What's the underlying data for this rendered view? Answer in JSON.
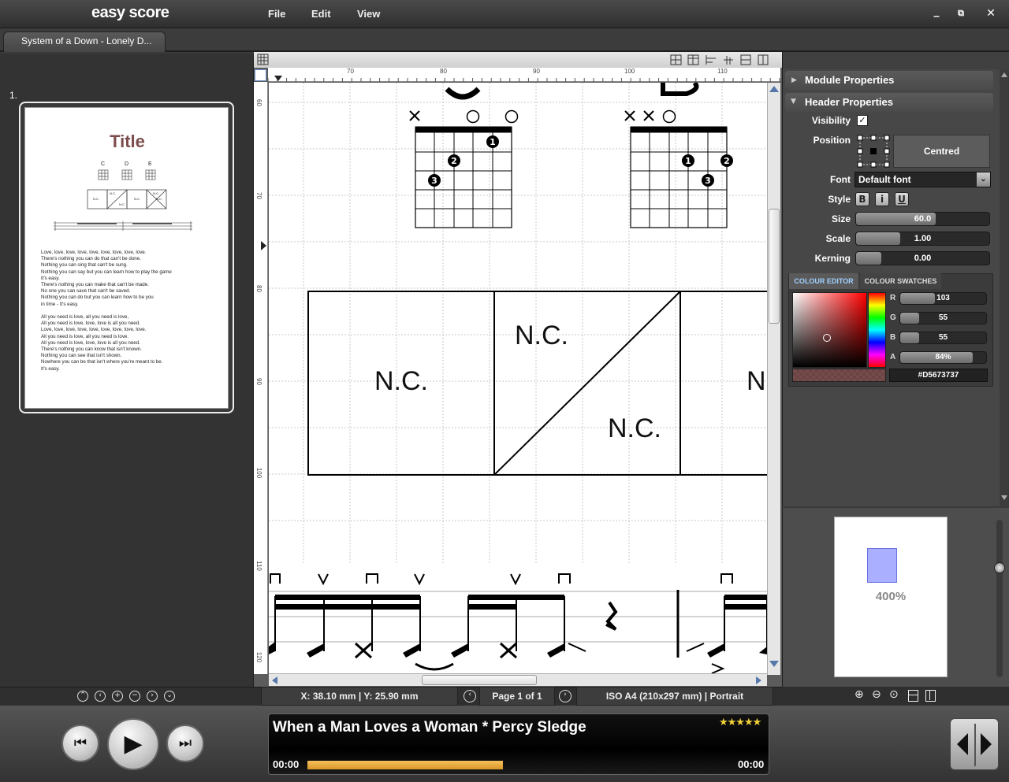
{
  "app": {
    "logo": "easy score",
    "menus": [
      "File",
      "Edit",
      "View"
    ],
    "window_controls": [
      "minimize-icon",
      "restore-icon",
      "close-icon"
    ]
  },
  "tab": {
    "label": "System of a Down - Lonely D..."
  },
  "pages_panel": {
    "page_number": "1.",
    "thumbnail": {
      "title": "Title",
      "chords": [
        "C",
        "D",
        "E"
      ],
      "boxes": [
        "N.C.",
        "N.C.",
        "N.C.",
        "N.C.",
        "N.C.",
        "N.C."
      ],
      "lyrics": [
        "Love, love, love, love, love, love, love, love, love.",
        "There's nothing you can do that can't be done.",
        "Nothing you can sing that can't be sung.",
        "Nothing you can say but you can learn how to play the game",
        "It's easy.",
        "There's nothing you can make that can't be made.",
        "No one you can save that can't be saved.",
        "Nothing you can do but you can learn how to be you",
        "in time - It's easy.",
        "",
        "All you need is love, all you need is love,",
        "All you need is love, love, love is all you need.",
        "Love, love, love, love, love, love, love, love, love.",
        "All you need is love, all you need is love.",
        "All you need is love, love, love is all you need.",
        "There's nothing you can know that isn't known.",
        "Nothing you can see that isn't shown.",
        "Nowhere you can be that isn't where you're meant to be.",
        "It's easy."
      ]
    },
    "nav_icons": [
      "first-page-icon",
      "previous-icon",
      "add-page-icon",
      "remove-page-icon",
      "next-icon",
      "last-page-icon"
    ]
  },
  "editor": {
    "ruler_top": [
      "70",
      "80",
      "90",
      "100",
      "110"
    ],
    "ruler_left": [
      "60",
      "70",
      "80",
      "90",
      "100",
      "110",
      "120"
    ],
    "chord_boxes": [
      {
        "text": "N.C."
      },
      {
        "text_top": "N.C.",
        "text_bottom": "N.C."
      },
      {
        "text": "N"
      }
    ],
    "status": {
      "coords": "X: 38.10 mm | Y: 25.90 mm",
      "page": "Page 1 of 1",
      "paper": "ISO A4 (210x297 mm) | Portrait"
    }
  },
  "properties": {
    "module_header": "Module Properties",
    "header_header": "Header Properties",
    "visibility_label": "Visibility",
    "visibility_checked": true,
    "position_label": "Position",
    "position_value": "Centred",
    "font_label": "Font",
    "font_value": "Default font",
    "style_label": "Style",
    "style_buttons": [
      "B",
      "i",
      "U"
    ],
    "size_label": "Size",
    "size_value": "60.0",
    "size_fraction": 0.6,
    "scale_label": "Scale",
    "scale_value": "1.00",
    "scale_fraction": 0.33,
    "kerning_label": "Kerning",
    "kerning_value": "0.00",
    "kerning_fraction": 0.19,
    "colour_tabs": [
      "COLOUR EDITOR",
      "COLOUR SWATCHES"
    ],
    "channels": [
      {
        "label": "R",
        "value": "103",
        "fraction": 0.4
      },
      {
        "label": "G",
        "value": "55",
        "fraction": 0.22
      },
      {
        "label": "B",
        "value": "55",
        "fraction": 0.22
      },
      {
        "label": "A",
        "value": "84%",
        "fraction": 0.84
      }
    ],
    "hex_value": "#D5673737",
    "swatch_color": "#673737"
  },
  "preview": {
    "zoom": "400%",
    "tools": [
      "zoom-in-icon",
      "zoom-out-icon",
      "zoom-fit-icon",
      "fit-width-icon",
      "fit-page-icon"
    ]
  },
  "player": {
    "song": "When a Man Loves a Woman * Percy Sledge",
    "time_elapsed": "00:00",
    "time_total": "00:00",
    "progress": 0.46,
    "rating": "★★★★★"
  }
}
